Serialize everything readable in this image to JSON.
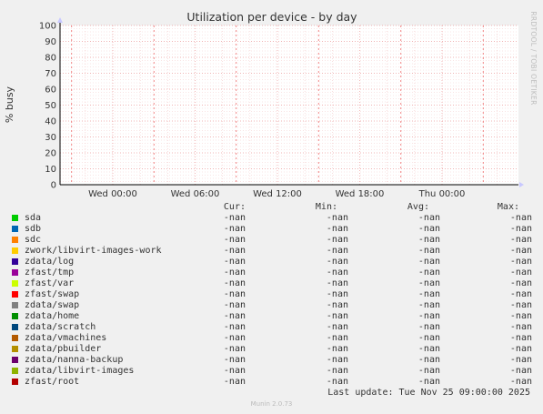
{
  "chart_data": {
    "type": "line",
    "title": "Utilization per device - by day",
    "ylabel": "% busy",
    "xlabel": "",
    "ylim": [
      0,
      100
    ],
    "yticks": [
      0,
      10,
      20,
      30,
      40,
      50,
      60,
      70,
      80,
      90,
      100
    ],
    "xticks": [
      "Wed 00:00",
      "Wed 06:00",
      "Wed 12:00",
      "Wed 18:00",
      "Thu 00:00"
    ],
    "grid": true,
    "series": [
      {
        "name": "sda",
        "color": "#00cc00",
        "cur": "-nan",
        "min": "-nan",
        "avg": "-nan",
        "max": "-nan"
      },
      {
        "name": "sdb",
        "color": "#0066b3",
        "cur": "-nan",
        "min": "-nan",
        "avg": "-nan",
        "max": "-nan"
      },
      {
        "name": "sdc",
        "color": "#ff8000",
        "cur": "-nan",
        "min": "-nan",
        "avg": "-nan",
        "max": "-nan"
      },
      {
        "name": "zwork/libvirt-images-work",
        "color": "#ffcc00",
        "cur": "-nan",
        "min": "-nan",
        "avg": "-nan",
        "max": "-nan"
      },
      {
        "name": "zdata/log",
        "color": "#330099",
        "cur": "-nan",
        "min": "-nan",
        "avg": "-nan",
        "max": "-nan"
      },
      {
        "name": "zfast/tmp",
        "color": "#990099",
        "cur": "-nan",
        "min": "-nan",
        "avg": "-nan",
        "max": "-nan"
      },
      {
        "name": "zfast/var",
        "color": "#ccff00",
        "cur": "-nan",
        "min": "-nan",
        "avg": "-nan",
        "max": "-nan"
      },
      {
        "name": "zfast/swap",
        "color": "#ff0000",
        "cur": "-nan",
        "min": "-nan",
        "avg": "-nan",
        "max": "-nan"
      },
      {
        "name": "zdata/swap",
        "color": "#808080",
        "cur": "-nan",
        "min": "-nan",
        "avg": "-nan",
        "max": "-nan"
      },
      {
        "name": "zdata/home",
        "color": "#008f00",
        "cur": "-nan",
        "min": "-nan",
        "avg": "-nan",
        "max": "-nan"
      },
      {
        "name": "zdata/scratch",
        "color": "#00487d",
        "cur": "-nan",
        "min": "-nan",
        "avg": "-nan",
        "max": "-nan"
      },
      {
        "name": "zdata/vmachines",
        "color": "#b35a00",
        "cur": "-nan",
        "min": "-nan",
        "avg": "-nan",
        "max": "-nan"
      },
      {
        "name": "zdata/pbuilder",
        "color": "#b38f00",
        "cur": "-nan",
        "min": "-nan",
        "avg": "-nan",
        "max": "-nan"
      },
      {
        "name": "zdata/nanna-backup",
        "color": "#6b006b",
        "cur": "-nan",
        "min": "-nan",
        "avg": "-nan",
        "max": "-nan"
      },
      {
        "name": "zdata/libvirt-images",
        "color": "#8fb300",
        "cur": "-nan",
        "min": "-nan",
        "avg": "-nan",
        "max": "-nan"
      },
      {
        "name": "zfast/root",
        "color": "#b30000",
        "cur": "-nan",
        "min": "-nan",
        "avg": "-nan",
        "max": "-nan"
      }
    ]
  },
  "legend_headers": {
    "cur": "Cur:",
    "min": "Min:",
    "avg": "Avg:",
    "max": "Max:"
  },
  "footer": {
    "last_update": "Last update: Tue Nov 25 09:00:00 2025",
    "version": "Munin 2.0.73"
  },
  "watermark": "RRDTOOL / TOBI OETIKER"
}
